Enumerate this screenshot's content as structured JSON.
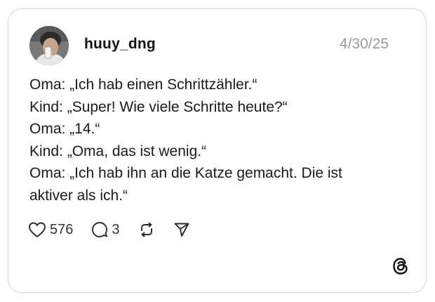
{
  "post": {
    "author": {
      "username": "huuy_dng",
      "avatar_icon": "user-avatar-photo"
    },
    "timestamp": "4/30/25",
    "lines": [
      "Oma: „Ich hab einen Schrittzähler.“",
      "Kind: „Super! Wie viele Schritte heute?“",
      "Oma: „14.“",
      "Kind: „Oma, das ist wenig.“",
      "Oma: „Ich hab ihn an die Katze gemacht. Die ist",
      "aktiver als ich.“"
    ],
    "actions": {
      "like": {
        "icon": "heart-icon",
        "count": "576"
      },
      "reply": {
        "icon": "comment-icon",
        "count": "3"
      },
      "repost": {
        "icon": "repost-icon"
      },
      "share": {
        "icon": "send-icon"
      }
    }
  },
  "branding": {
    "logo_icon": "threads-logo-icon"
  },
  "colors": {
    "border": "#d6d6d6",
    "timestamp": "#9a9a9a",
    "text": "#1a1a1a",
    "icon": "#2a2a2a"
  }
}
